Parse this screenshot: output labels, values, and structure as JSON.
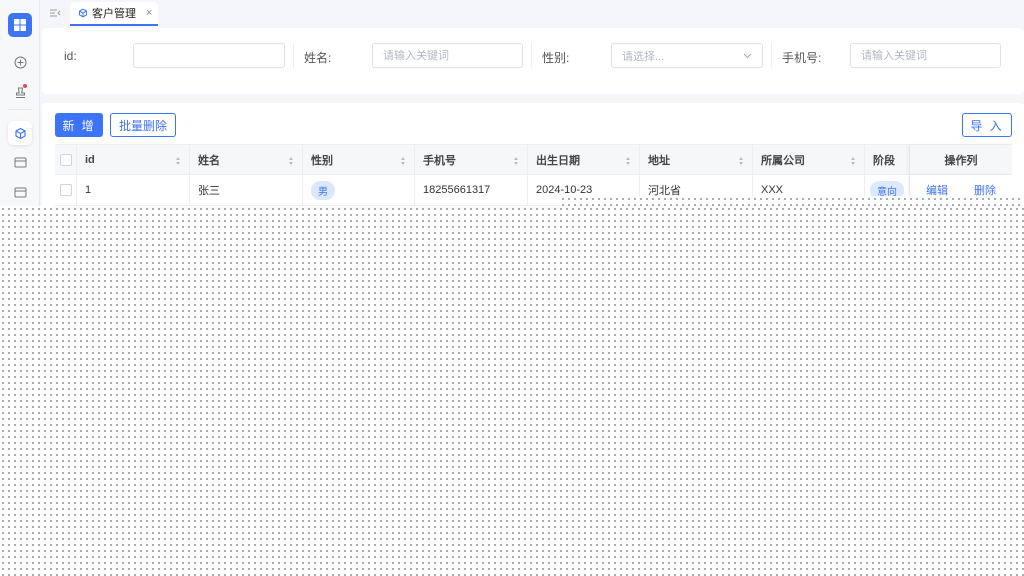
{
  "theme": {
    "accent": "#3d73f5",
    "danger": "#f04848"
  },
  "sidebar": {
    "logo_icon": "windows-logo-icon",
    "items": [
      {
        "name": "add-circle-icon"
      },
      {
        "name": "stamp-icon",
        "has_badge": true
      },
      {
        "name": "cube-icon",
        "active": true
      },
      {
        "name": "card-icon"
      },
      {
        "name": "card-icon-2"
      }
    ]
  },
  "tabs": [
    {
      "label": "客户管理",
      "close": "×"
    }
  ],
  "search": {
    "fields": [
      {
        "label": "id:",
        "placeholder": ""
      },
      {
        "label": "姓名:",
        "placeholder": "请输入关键词"
      },
      {
        "label": "性别:",
        "placeholder": "请选择..."
      },
      {
        "label": "手机号:",
        "placeholder": "请输入关键词"
      }
    ]
  },
  "toolbar": {
    "add_label": "新 增",
    "batch_delete_label": "批量删除",
    "import_label": "导 入"
  },
  "table": {
    "columns": [
      "id",
      "姓名",
      "性别",
      "手机号",
      "出生日期",
      "地址",
      "所属公司",
      "阶段",
      "操作列"
    ],
    "rows": [
      {
        "id": "1",
        "name": "张三",
        "gender": "男",
        "phone": "18255661317",
        "birth": "2024-10-23",
        "address": "河北省",
        "company": "XXX",
        "stage": "意向",
        "edit": "编辑",
        "delete": "删除"
      }
    ]
  }
}
